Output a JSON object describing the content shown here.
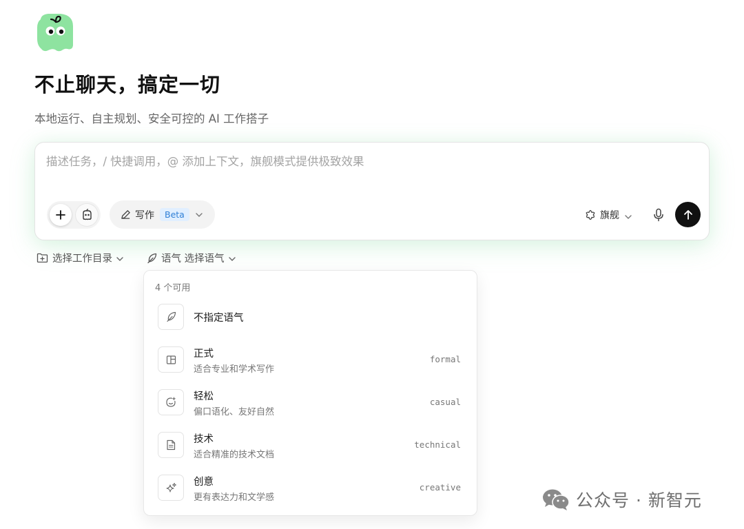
{
  "hero": {
    "headline": "不止聊天，搞定一切",
    "subtitle": "本地运行、自主规划、安全可控的 AI 工作搭子"
  },
  "composer": {
    "placeholder": "描述任务，/ 快捷调用，@ 添加上下文，旗舰模式提供极致效果",
    "value": "",
    "mode_label": "写作",
    "mode_badge": "Beta",
    "model_label": "旗舰"
  },
  "bottom_bar": {
    "workdir_label": "选择工作目录",
    "tone_label": "语气 选择语气"
  },
  "tone_menu": {
    "count_label": "4 个可用",
    "items": [
      {
        "title": "不指定语气",
        "desc": "",
        "key": ""
      },
      {
        "title": "正式",
        "desc": "适合专业和学术写作",
        "key": "formal"
      },
      {
        "title": "轻松",
        "desc": "偏口语化、友好自然",
        "key": "casual"
      },
      {
        "title": "技术",
        "desc": "适合精准的技术文档",
        "key": "technical"
      },
      {
        "title": "创意",
        "desc": "更有表达力和文学感",
        "key": "creative"
      }
    ]
  },
  "watermark": {
    "text": "公众号 · 新智元"
  },
  "colors": {
    "brand_green": "#8ee3a0",
    "send_button": "#111111",
    "beta_badge_bg": "#e1efff",
    "beta_badge_text": "#2f7fd6"
  },
  "icons": {
    "logo": "ghost-mascot-logo",
    "plus": "plus-icon",
    "mascot": "mascot-icon",
    "pen": "pen-icon",
    "model": "flower-icon",
    "mic": "microphone-icon",
    "send": "arrow-up-icon",
    "folder": "folder-plus-icon",
    "feather": "feather-icon",
    "formal": "layout-icon",
    "casual": "smile-sparkle-icon",
    "technical": "document-icon",
    "creative": "sparkles-icon",
    "wechat": "wechat-icon"
  }
}
